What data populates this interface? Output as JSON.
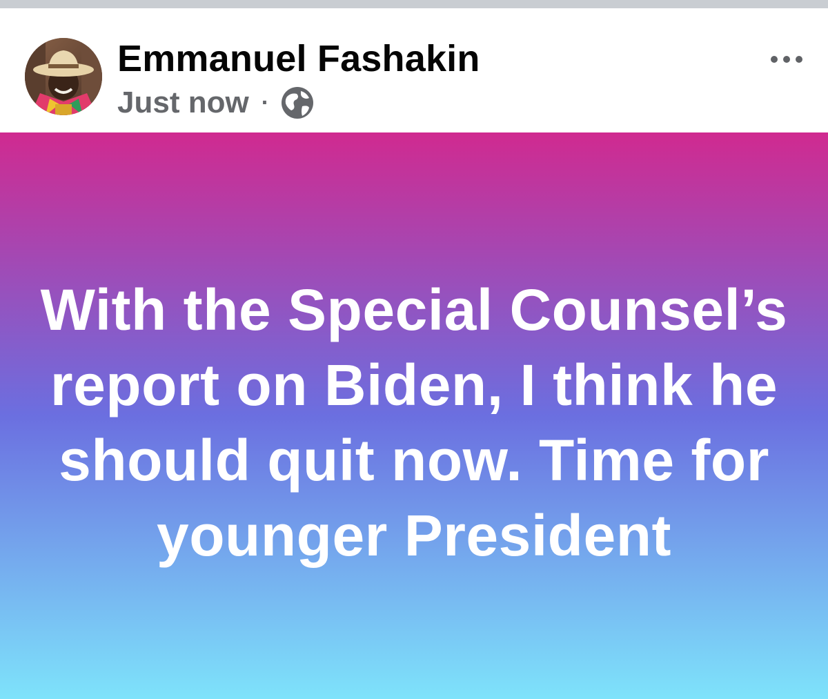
{
  "post": {
    "author_name": "Emmanuel Fashakin",
    "timestamp": "Just now",
    "separator": "·",
    "audience_icon": "globe-icon",
    "more_icon": "more-options-icon",
    "text": "With the Special Counsel’s report on Biden, I think he should quit now. Time for younger President",
    "background_gradient": {
      "top_color": "#d02a90",
      "middle_color": "#6b6fe0",
      "bottom_color": "#7ee3fb"
    }
  },
  "colors": {
    "name_text": "#050505",
    "meta_text": "#65676b",
    "post_text": "#ffffff",
    "top_strip": "#c9cdd2"
  }
}
